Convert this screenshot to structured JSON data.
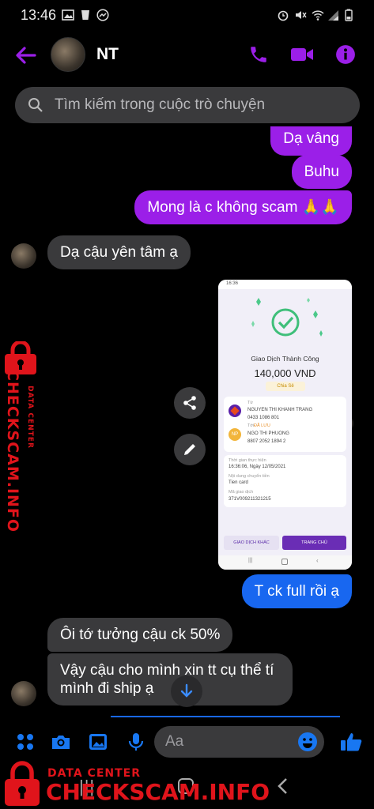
{
  "status_bar": {
    "time": "13:46"
  },
  "header": {
    "contact_name": "NT"
  },
  "search": {
    "placeholder": "Tìm kiếm trong cuộc trò chuyện"
  },
  "messages": [
    {
      "text": "Dạ vâng",
      "direction": "outgoing"
    },
    {
      "text": "Buhu",
      "direction": "outgoing"
    },
    {
      "text": "Mong là c không scam 🙏🙏",
      "direction": "outgoing"
    },
    {
      "text": "Dạ cậu yên tâm ạ",
      "direction": "incoming"
    },
    {
      "text": "T ck full rồi ạ",
      "direction": "outgoing"
    },
    {
      "text": "Ôi tớ tưởng cậu ck 50%",
      "direction": "incoming"
    },
    {
      "text_line1": "Vậy cậu cho mình xin tt cụ thể tí",
      "text_line2": "mình đi ship ạ",
      "direction": "incoming"
    }
  ],
  "receipt": {
    "time": "16:36",
    "title": "Giao Dịch Thành Công",
    "amount": "140,000 VND",
    "share": "Chia Sẻ",
    "from_label": "Từ",
    "from_name": "NGUYEN THI KHANH TRANG",
    "from_account": "0433 1086 801",
    "to_label": "Tới",
    "to_bank": "ĐÃ LƯU",
    "to_avatar": "NP",
    "to_name": "NGO THI PHUONG",
    "to_account": "8807 2052 1894 2",
    "time_label": "Thời gian thực hiện",
    "time_value": "16:36:06, Ngày 12/05/2021",
    "content_label": "Nội dung chuyển tiền",
    "content_value": "Tien card",
    "txn_label": "Mã giao dịch",
    "txn_value": "371V009211321215",
    "btn_left": "GIAO DỊCH KHÁC",
    "btn_right": "TRANG CHỦ"
  },
  "composer": {
    "placeholder": "Aa"
  },
  "watermark": {
    "side_small": "DATA CENTER",
    "side_big": "CHECKSCAM.INFO",
    "bottom_small": "DATA CENTER",
    "bottom_big": "CHECKSCAM.INFO"
  },
  "colors": {
    "accent": "#9b1fe8",
    "outgoing_blue": "#1867f0",
    "incoming": "#3a3a3c",
    "watermark_red": "#e0141b"
  }
}
